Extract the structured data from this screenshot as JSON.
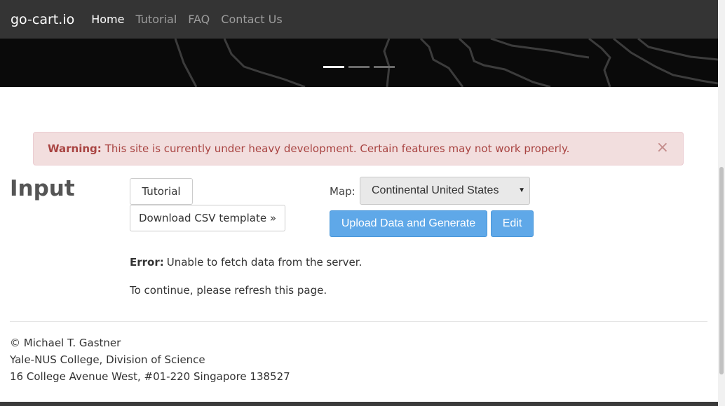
{
  "navbar": {
    "brand": "go-cart.io",
    "links": [
      {
        "label": "Home",
        "active": true
      },
      {
        "label": "Tutorial",
        "active": false
      },
      {
        "label": "FAQ",
        "active": false
      },
      {
        "label": "Contact Us",
        "active": false
      }
    ]
  },
  "carousel": {
    "active_slide": 1,
    "slide_count": 3
  },
  "alert": {
    "label": "Warning:",
    "message": "This site is currently under heavy development. Certain features may not work properly.",
    "close_symbol": "×"
  },
  "input_section": {
    "title": "Input",
    "tutorial_button": "Tutorial",
    "csv_button": "Download CSV template »",
    "map_label": "Map:",
    "map_selected": "Continental United States",
    "upload_button": "Upload Data and Generate",
    "edit_button": "Edit",
    "error_label": "Error:",
    "error_message": "Unable to fetch data from the server.",
    "refresh_message": "To continue, please refresh this page."
  },
  "footer": {
    "line1": "© Michael T. Gastner",
    "line2": "Yale-NUS College, Division of Science",
    "line3": "16 College Avenue West, #01-220 Singapore 138527"
  },
  "colors": {
    "navbar_bg": "#343434",
    "alert_bg": "#f2dede",
    "alert_text": "#a94442",
    "primary_button": "#5fa8e8"
  }
}
